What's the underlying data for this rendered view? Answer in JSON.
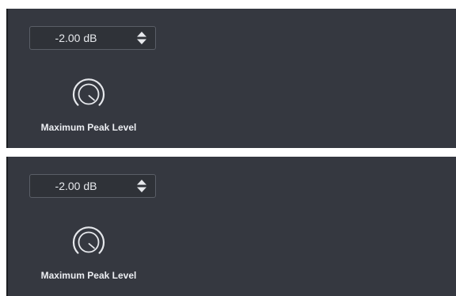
{
  "panels": [
    {
      "value_field": {
        "value": "-2.00 dB"
      },
      "knob": {
        "icon": "knob-icon"
      },
      "label": "Maximum Peak Level"
    },
    {
      "value_field": {
        "value": "-2.00 dB"
      },
      "knob": {
        "icon": "knob-icon"
      },
      "label": "Maximum Peak Level"
    }
  ],
  "colors": {
    "panel_bg": "#353840",
    "text": "#e6e8ec",
    "field_border": "#5a5e67"
  }
}
